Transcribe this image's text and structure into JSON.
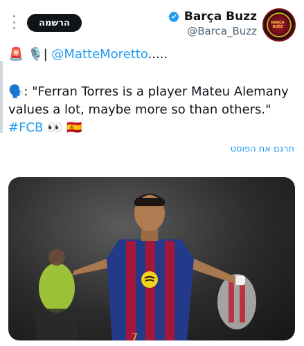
{
  "header": {
    "display_name": "Barça Buzz",
    "handle": "@Barca_Buzz",
    "follow_label": "הרשמה",
    "avatar_text": "BARÇA BUZZ"
  },
  "tweet": {
    "line1_emojis": [
      "🚨",
      "🎙️"
    ],
    "line1_separator": "|",
    "mention": "@MatteMoretto",
    "line1_suffix": ".....",
    "quote_prefix_emoji": "🗣️",
    "quote_text": ": \"Ferran Torres is a player Mateu Alemany values a lot, maybe more so than others.\"",
    "hashtag": "#FCB",
    "trailing_emojis": [
      "👀",
      "🇪🇸"
    ]
  },
  "translate_label": "תרגם את הפוסט",
  "media": {
    "jersey_number": "7",
    "image_kind": "football-player-celebration-photo"
  },
  "colors": {
    "link_blue": "#1d9bf0",
    "text_dark": "#0f1419",
    "muted": "#536471",
    "verified_blue": "#1d9bf0"
  }
}
